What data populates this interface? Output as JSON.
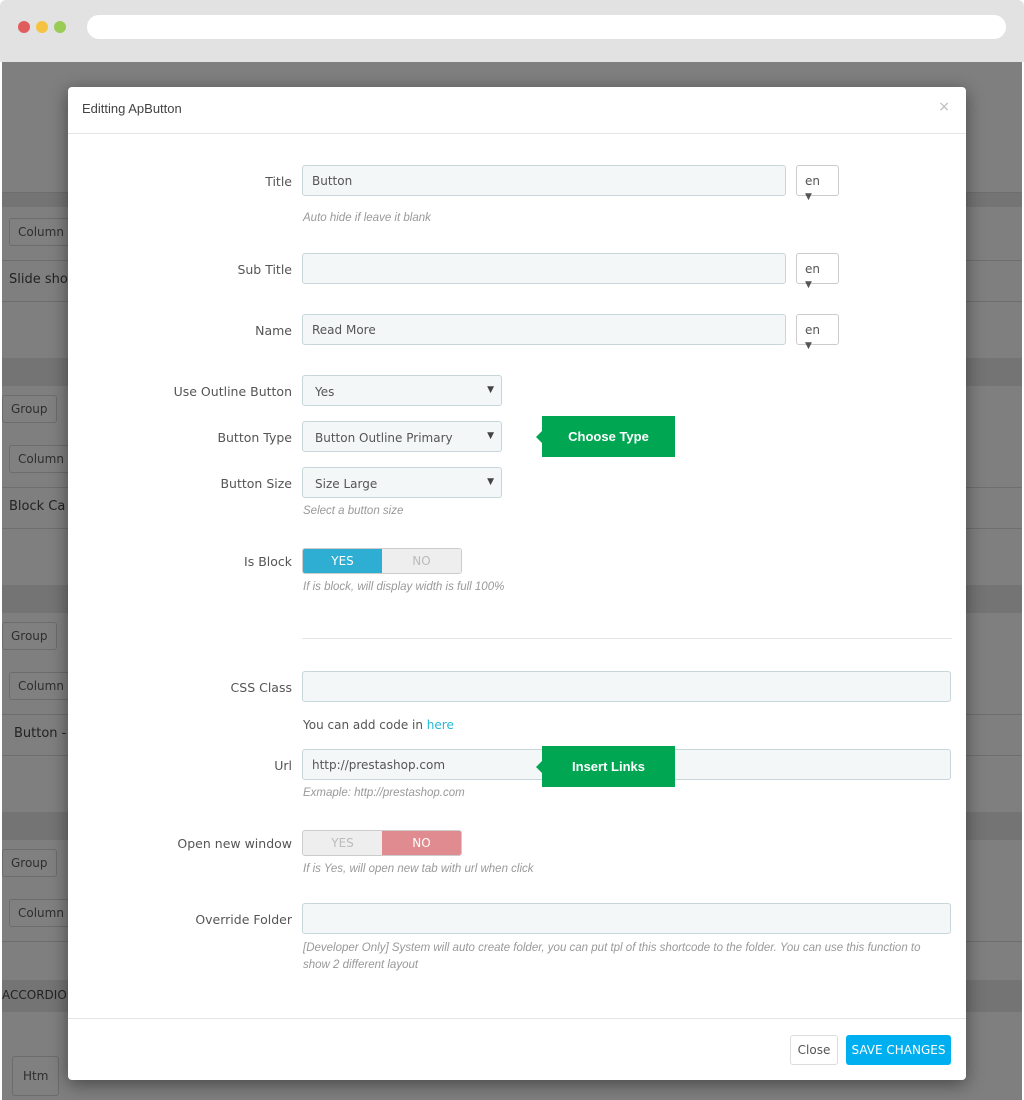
{
  "browser": {
    "dots": [
      "#e05d5d",
      "#f5c342",
      "#99cc55"
    ]
  },
  "background": {
    "items": [
      "Column",
      "Slide sho",
      "Group",
      "Column",
      "Block Ca",
      "Group",
      "Column",
      "Button -",
      "Group",
      "Column",
      "ACCORDION",
      "Htm"
    ]
  },
  "modal": {
    "title": "Editting ApButton",
    "close_icon": "×",
    "fields": {
      "title": {
        "label": "Title",
        "value": "Button",
        "lang": "en",
        "help": "Auto hide if leave it blank"
      },
      "sub_title": {
        "label": "Sub Title",
        "value": "",
        "lang": "en"
      },
      "name": {
        "label": "Name",
        "value": "Read More",
        "lang": "en"
      },
      "use_outline": {
        "label": "Use Outline Button",
        "value": "Yes"
      },
      "button_type": {
        "label": "Button Type",
        "value": "Button Outline Primary"
      },
      "button_size": {
        "label": "Button Size",
        "value": "Size Large",
        "help": "Select a button size"
      },
      "is_block": {
        "label": "Is Block",
        "yes": "YES",
        "no": "NO",
        "selected": "YES",
        "help": "If is block, will display width is full 100%"
      },
      "css_class": {
        "label": "CSS Class",
        "value": "",
        "help_prefix": "You can add code in ",
        "help_link": "here"
      },
      "url": {
        "label": "Url",
        "value": "http://prestashop.com",
        "help": "Exmaple: http://prestashop.com"
      },
      "open_new_window": {
        "label": "Open new window",
        "yes": "YES",
        "no": "NO",
        "selected": "NO",
        "help": "If is Yes, will open new tab with url when click"
      },
      "override_folder": {
        "label": "Override Folder",
        "value": "",
        "help": "[Developer Only] System will auto create folder, you can put tpl of this shortcode to the folder. You can use this function to show 2 different layout"
      }
    },
    "callouts": {
      "choose_type": "Choose Type",
      "insert_links": "Insert Links"
    },
    "footer": {
      "close": "Close",
      "save": "SAVE CHANGES"
    },
    "colors": {
      "toggle_yes": "#2eaed3",
      "toggle_no": "#e08b8f",
      "callout": "#00a651",
      "save": "#00aff0",
      "link": "#25b9d7"
    }
  }
}
